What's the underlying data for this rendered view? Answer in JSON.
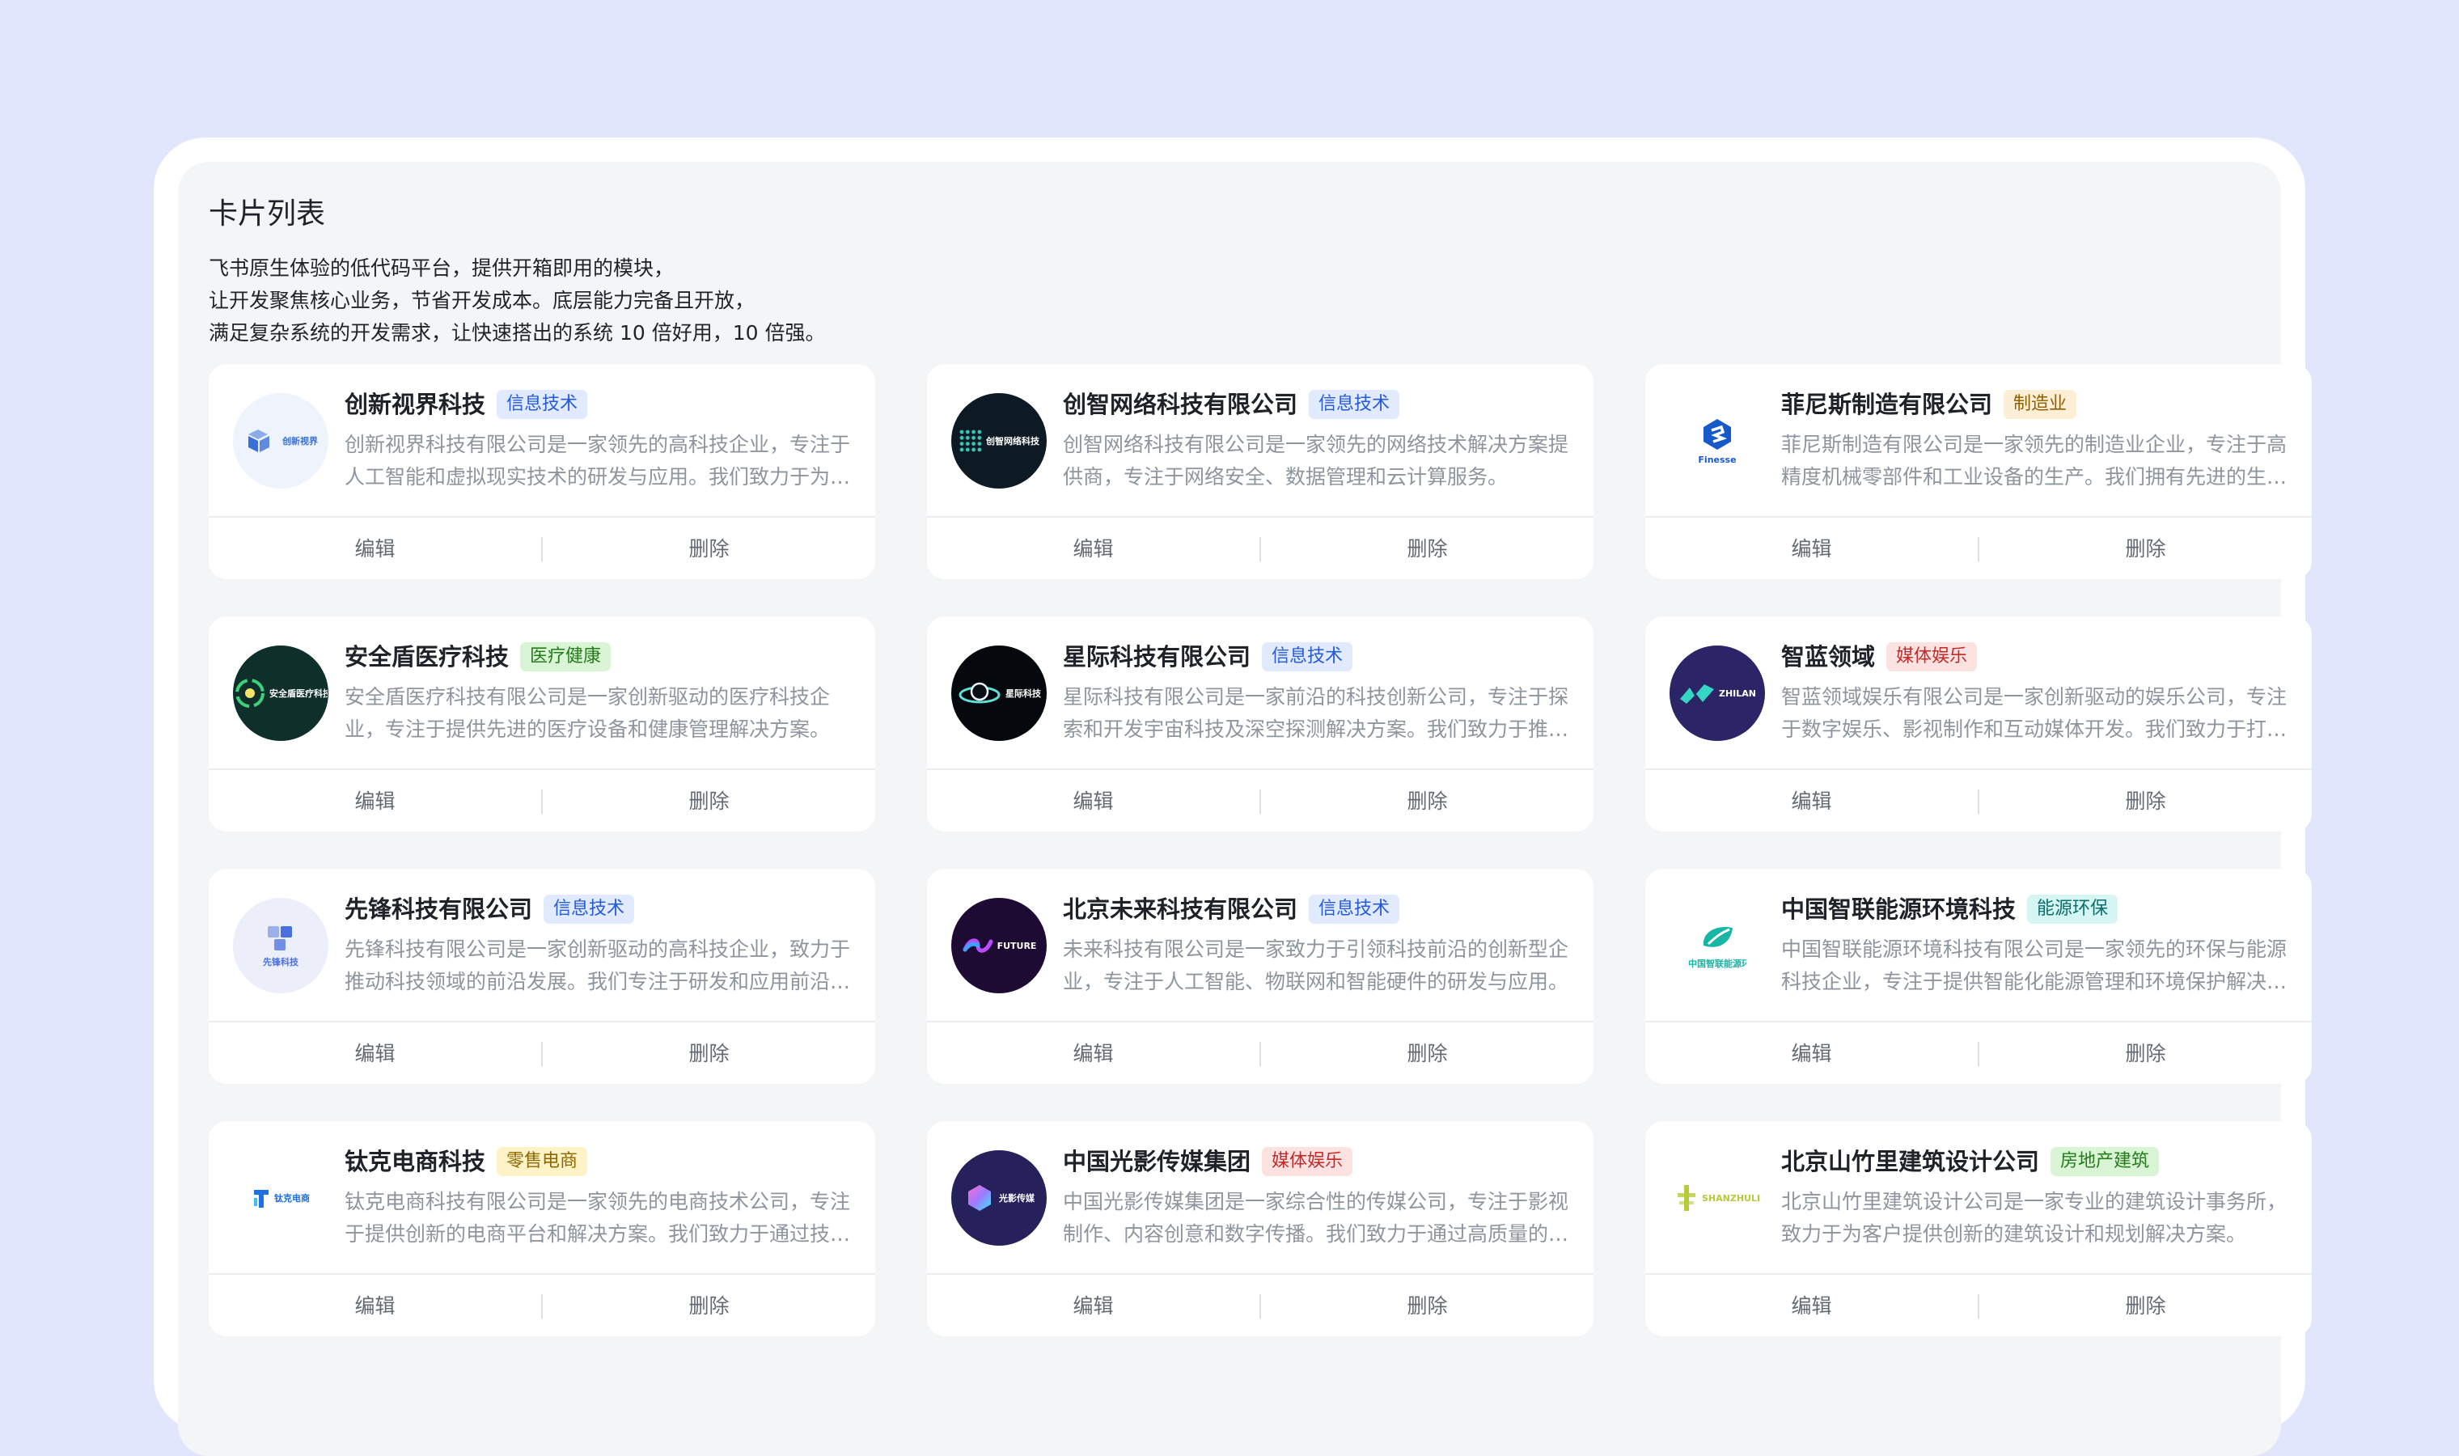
{
  "page": {
    "title": "卡片列表",
    "description": [
      "飞书原生体验的低代码平台，提供开箱即用的模块，",
      "让开发聚焦核心业务，节省开发成本。底层能力完备且开放，",
      "满足复杂系统的开发需求，让快速搭出的系统 10 倍好用，10 倍强。"
    ]
  },
  "actions": {
    "edit": "编辑",
    "delete": "删除"
  },
  "tag_colors": {
    "信息技术": {
      "bg": "#e1eaff",
      "fg": "#245bdb"
    },
    "制造业": {
      "bg": "#fdefd6",
      "fg": "#8f5e00"
    },
    "医疗健康": {
      "bg": "#d9f5d6",
      "fg": "#237b19"
    },
    "媒体娱乐": {
      "bg": "#fde2e2",
      "fg": "#c02a2a"
    },
    "能源环保": {
      "bg": "#d5f6f2",
      "fg": "#0b6e6c"
    },
    "零售电商": {
      "bg": "#fdf3c7",
      "fg": "#8f6700"
    },
    "房地产建筑": {
      "bg": "#d9f5d6",
      "fg": "#237b19"
    }
  },
  "cards": [
    {
      "name": "创新视界科技",
      "tag": "信息技术",
      "summary": "创新视界科技有限公司是一家领先的高科技企业，专注于人工智能和虚拟现实技术的研发与应用。我们致力于为客户提供创新的解决方案。",
      "logo": {
        "icon": "cube-logo-icon",
        "text": "创新视界",
        "bg": "#eef3fc",
        "fg": "#3b6fd8"
      }
    },
    {
      "name": "创智网络科技有限公司",
      "tag": "信息技术",
      "summary": "创智网络科技有限公司是一家领先的网络技术解决方案提供商，专注于网络安全、数据管理和云计算服务。",
      "logo": {
        "icon": "grid-logo-icon",
        "text": "创智网络科技",
        "bg": "#0d1a24",
        "fg": "#37c4b8"
      }
    },
    {
      "name": "菲尼斯制造有限公司",
      "tag": "制造业",
      "summary": "菲尼斯制造有限公司是一家领先的制造业企业，专注于高精度机械零部件和工业设备的生产。我们拥有先进的生产线。",
      "logo": {
        "icon": "hex-logo-icon",
        "text": "Finesse",
        "bg": "#ffffff",
        "fg": "#1659c9"
      }
    },
    {
      "name": "安全盾医疗科技",
      "tag": "医疗健康",
      "summary": "安全盾医疗科技有限公司是一家创新驱动的医疗科技企业，专注于提供先进的医疗设备和健康管理解决方案。",
      "logo": {
        "icon": "shield-logo-icon",
        "text": "安全盾医疗科技",
        "bg": "#0e2f2a",
        "fg": "#3fd07a"
      }
    },
    {
      "name": "星际科技有限公司",
      "tag": "信息技术",
      "summary": "星际科技有限公司是一家前沿的科技创新公司，专注于探索和开发宇宙科技及深空探测解决方案。我们致力于推动人类探索。",
      "logo": {
        "icon": "planet-logo-icon",
        "text": "星际科技",
        "bg": "#05080c",
        "fg": "#5de0d6"
      }
    },
    {
      "name": "智蓝领域",
      "tag": "媒体娱乐",
      "summary": "智蓝领域娱乐有限公司是一家创新驱动的娱乐公司，专注于数字娱乐、影视制作和互动媒体开发。我们致力于打造精品内容。",
      "logo": {
        "icon": "zhilan-logo-icon",
        "text": "ZHILAN",
        "bg": "#2b2466",
        "fg": "#35d6c3"
      }
    },
    {
      "name": "先锋科技有限公司",
      "tag": "信息技术",
      "summary": "先锋科技有限公司是一家创新驱动的高科技企业，致力于推动科技领域的前沿发展。我们专注于研发和应用前沿技术。",
      "logo": {
        "icon": "blocks-logo-icon",
        "text": "先锋科技",
        "bg": "#eceffa",
        "fg": "#4a6fe0"
      }
    },
    {
      "name": "北京未来科技有限公司",
      "tag": "信息技术",
      "summary": "未来科技有限公司是一家致力于引领科技前沿的创新型企业，专注于人工智能、物联网和智能硬件的研发与应用。",
      "logo": {
        "icon": "future-logo-icon",
        "text": "FUTURE",
        "bg": "#1e0b33",
        "fg": "#b84dff"
      }
    },
    {
      "name": "中国智联能源环境科技",
      "tag": "能源环保",
      "summary": "中国智联能源环境科技有限公司是一家领先的环保与能源科技企业，专注于提供智能化能源管理和环境保护解决方案。",
      "logo": {
        "icon": "leaf-logo-icon",
        "text": "中国智联能源环境科技",
        "bg": "#ffffff",
        "fg": "#17b6a7"
      }
    },
    {
      "name": "钛克电商科技",
      "tag": "零售电商",
      "summary": "钛克电商科技有限公司是一家领先的电商技术公司，专注于提供创新的电商平台和解决方案。我们致力于通过技术赋能零售。",
      "logo": {
        "icon": "tike-logo-icon",
        "text": "钛克电商",
        "bg": "#ffffff",
        "fg": "#1f6fe5"
      }
    },
    {
      "name": "中国光影传媒集团",
      "tag": "媒体娱乐",
      "summary": "中国光影传媒集团是一家综合性的传媒公司，专注于影视制作、内容创意和数字传播。我们致力于通过高质量的内容服务观众。",
      "logo": {
        "icon": "light-logo-icon",
        "text": "光影传媒",
        "bg": "#26215a",
        "fg": "#9b7bff"
      }
    },
    {
      "name": "北京山竹里建筑设计公司",
      "tag": "房地产建筑",
      "summary": "北京山竹里建筑设计公司是一家专业的建筑设计事务所，致力于为客户提供创新的建筑设计和规划解决方案。",
      "logo": {
        "icon": "bamboo-logo-icon",
        "text": "SHANZHULI",
        "bg": "#ffffff",
        "fg": "#b8c93a"
      }
    }
  ]
}
